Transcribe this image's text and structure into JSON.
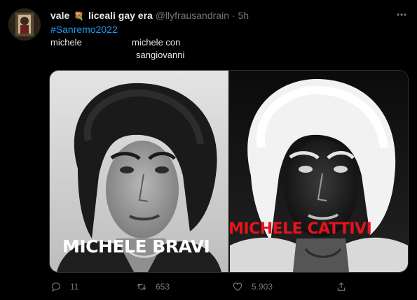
{
  "tweet": {
    "author_name": "vale",
    "author_name_suffix": "liceali gay era",
    "handle": "@llyfrausandrain",
    "separator": "·",
    "time": "5h",
    "hashtag": "#Sanremo2022",
    "text_col1": "michele",
    "text_col2_line1": "michele con",
    "text_col2_line2": "sangiovanni",
    "images": [
      {
        "caption": "MICHELE BRAVI",
        "caption_color": "#ffffff"
      },
      {
        "caption": "MICHELE CATTIVI",
        "caption_color": "#e6141b"
      }
    ]
  },
  "actions": {
    "reply_count": "11",
    "retweet_count": "653",
    "like_count": "5.903"
  },
  "icons": {
    "author_emoji": "flower-icon",
    "more": "more-icon",
    "reply": "reply-icon",
    "retweet": "retweet-icon",
    "like": "heart-icon",
    "share": "share-icon"
  },
  "colors": {
    "background": "#000000",
    "text": "#e7e9ea",
    "secondary_text": "#71767b",
    "link": "#1d9bf0",
    "caption_red": "#e6141b"
  }
}
